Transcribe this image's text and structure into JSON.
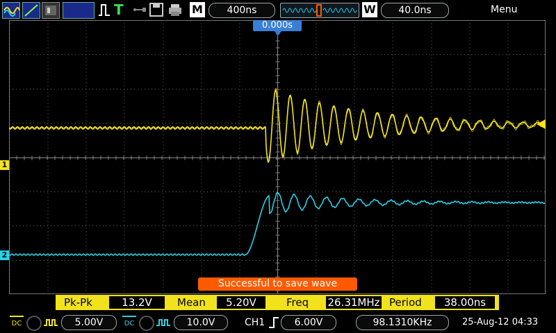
{
  "toolbar": {
    "time_scale_label": "M",
    "time_scale": "400ns",
    "window_label": "W",
    "window_scale": "40.0ns",
    "menu": "Menu"
  },
  "screen": {
    "trigger_time": "0.000s",
    "ch1_marker": "1",
    "ch2_marker": "2",
    "save_message": "Successful to save wave"
  },
  "measurements": [
    {
      "label": "Pk-Pk",
      "value": "13.2V"
    },
    {
      "label": "Mean",
      "value": "5.20V"
    },
    {
      "label": "Freq",
      "value": "26.31MHz"
    },
    {
      "label": "Period",
      "value": "38.00ns"
    }
  ],
  "bottom": {
    "ch1_coupling": "DC",
    "ch1_volts": "5.00V",
    "ch2_coupling": "DC",
    "ch2_volts": "10.0V",
    "trigger_source": "CH1",
    "trigger_level": "6.00V",
    "trigger_freq": "98.1310KHz",
    "datetime": "25-Aug-12 04:33"
  },
  "colors": {
    "ch1": "#f5e31c",
    "ch2": "#2ad0e6",
    "accent": "#ff5a00",
    "trigger_marker": "#3a7fd6"
  }
}
